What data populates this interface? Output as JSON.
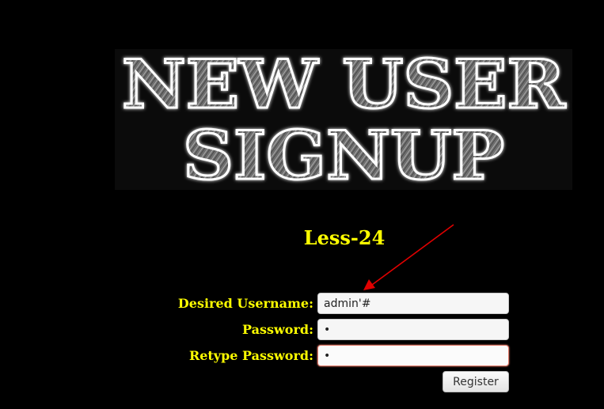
{
  "banner": {
    "line1": "NEW USER",
    "line2": "SIGNUP"
  },
  "lesson": {
    "title": "Less-24"
  },
  "form": {
    "username_label": "Desired Username:",
    "username_value": "admin'#",
    "password_label": "Password:",
    "password_value": "a",
    "retype_label": "Retype Password:",
    "retype_value": "a",
    "register_label": "Register"
  },
  "colors": {
    "background": "#000000",
    "label": "#ffff00",
    "arrow": "#e00000",
    "focus_border": "#e07a6a"
  }
}
